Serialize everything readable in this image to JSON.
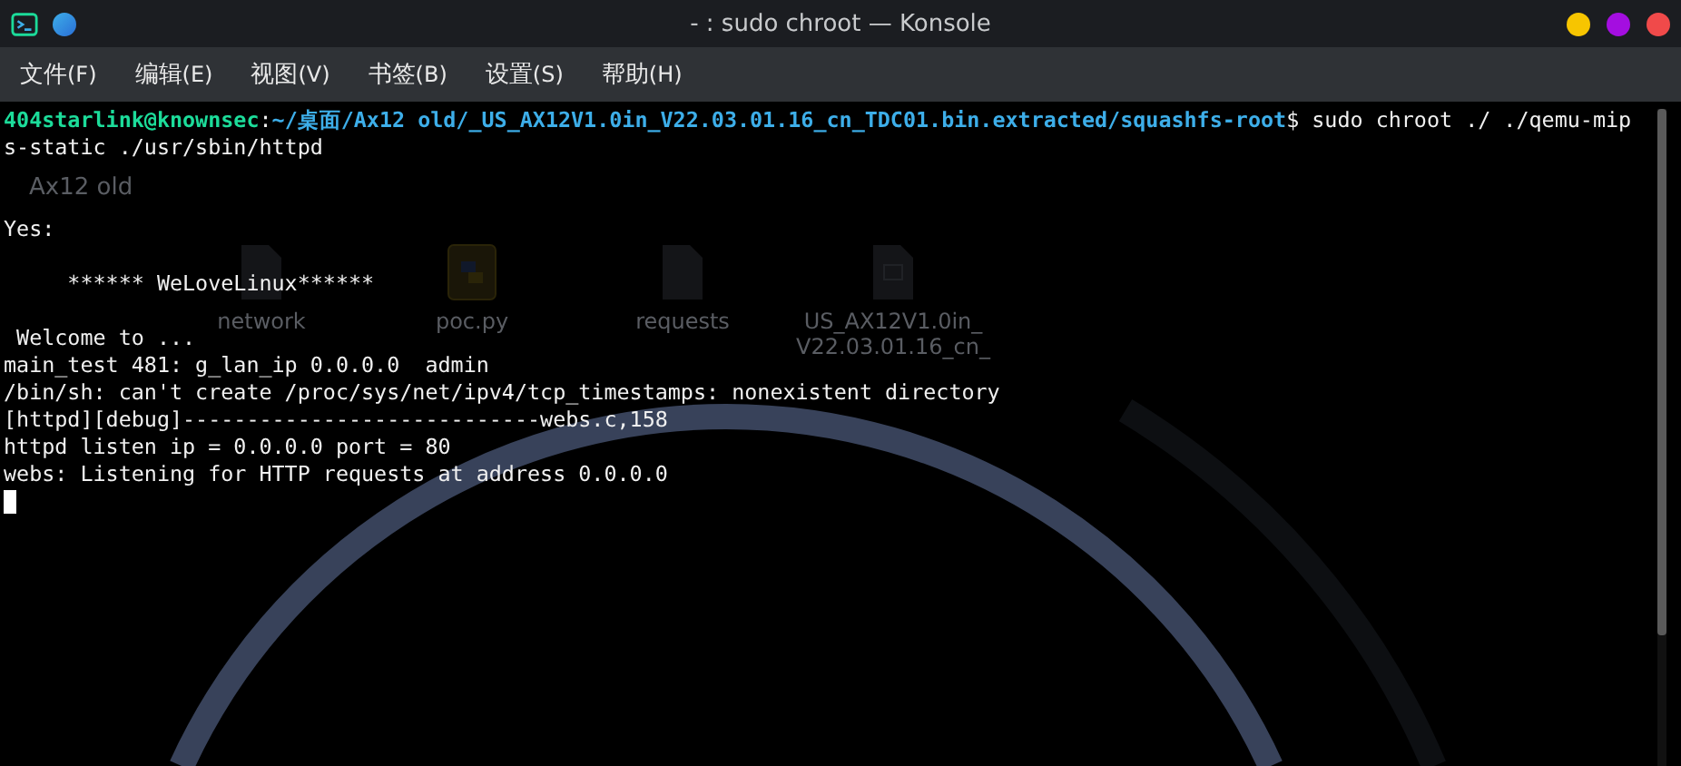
{
  "window": {
    "title": "- : sudo chroot — Konsole"
  },
  "menu": [
    {
      "label": "文件",
      "key": "(F)"
    },
    {
      "label": "编辑",
      "key": "(E)"
    },
    {
      "label": "视图",
      "key": "(V)"
    },
    {
      "label": "书签",
      "key": "(B)"
    },
    {
      "label": "设置",
      "key": "(S)"
    },
    {
      "label": "帮助",
      "key": "(H)"
    }
  ],
  "background_window": {
    "title": "Ax12 old",
    "files": [
      {
        "name": "network",
        "kind": "doc"
      },
      {
        "name": "poc.py",
        "kind": "python"
      },
      {
        "name": "requests",
        "kind": "doc"
      },
      {
        "name": "US_AX12V1.0in_ V22.03.01.16_cn_",
        "kind": "unknown"
      }
    ]
  },
  "terminal": {
    "lines": [
      {
        "kind": "prompt",
        "user": "404starlink@knownsec",
        "separator": ":",
        "path": "~/桌面/Ax12 old/_US_AX12V1.0in_V22.03.01.16_cn_TDC01.bin.extracted/squashfs-root",
        "command": "$ sudo chroot ./ ./qemu-mip"
      },
      {
        "kind": "output",
        "text": "s-static ./usr/sbin/httpd"
      },
      {
        "kind": "blank"
      },
      {
        "kind": "blank"
      },
      {
        "kind": "output",
        "text": "Yes:"
      },
      {
        "kind": "blank"
      },
      {
        "kind": "output",
        "text": "     ****** WeLoveLinux******"
      },
      {
        "kind": "blank"
      },
      {
        "kind": "output",
        "text": " Welcome to ..."
      },
      {
        "kind": "output",
        "text": "main_test 481: g_lan_ip 0.0.0.0  admin"
      },
      {
        "kind": "output",
        "text": "/bin/sh: can't create /proc/sys/net/ipv4/tcp_timestamps: nonexistent directory"
      },
      {
        "kind": "output",
        "text": "[httpd][debug]----------------------------webs.c,158"
      },
      {
        "kind": "output",
        "text": "httpd listen ip = 0.0.0.0 port = 80"
      },
      {
        "kind": "output",
        "text": "webs: Listening for HTTP requests at address 0.0.0.0"
      },
      {
        "kind": "cursor"
      }
    ]
  }
}
